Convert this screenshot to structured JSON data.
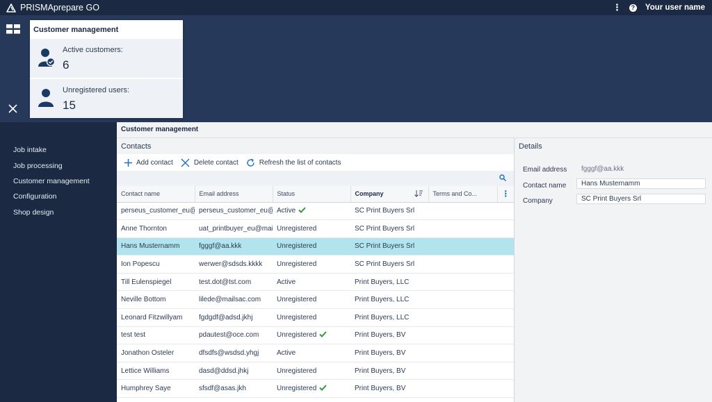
{
  "app": {
    "title": "PRISMAprepare GO",
    "user_name": "Your user name"
  },
  "nav": {
    "items": [
      {
        "label": "Job intake"
      },
      {
        "label": "Job processing"
      },
      {
        "label": "Customer management"
      },
      {
        "label": "Configuration"
      },
      {
        "label": "Shop design"
      }
    ]
  },
  "dashboard_card": {
    "title": "Customer management",
    "stats": [
      {
        "label": "Active customers:",
        "value": "6",
        "icon": "user-check-icon"
      },
      {
        "label": "Unregistered users:",
        "value": "15",
        "icon": "user-icon"
      }
    ]
  },
  "content": {
    "title": "Customer management",
    "contacts_title": "Contacts",
    "toolbar": {
      "add_label": "Add contact",
      "delete_label": "Delete contact",
      "refresh_label": "Refresh the list of contacts"
    },
    "columns": [
      "Contact name",
      "Email address",
      "Status",
      "Company",
      "Terms and Co..."
    ],
    "rows": [
      {
        "name": "perseus_customer_eu@n",
        "email": "perseus_customer_eu@n",
        "status": "Active",
        "check": true,
        "company": "SC Print Buyers Srl"
      },
      {
        "name": "Anne Thornton",
        "email": "uat_printbuyer_eu@mail",
        "status": "Unregistered",
        "check": false,
        "company": "SC Print Buyers Srl"
      },
      {
        "name": "Hans Musternamm",
        "email": "fgggf@aa.kkk",
        "status": "Unregistered",
        "check": false,
        "company": "SC Print Buyers Srl",
        "selected": true
      },
      {
        "name": "Ion Popescu",
        "email": "werwer@sdsds.kkkk",
        "status": "Unregistered",
        "check": false,
        "company": "SC Print Buyers Srl"
      },
      {
        "name": "Till Eulenspiegel",
        "email": "test.dot@tst.com",
        "status": "Active",
        "check": false,
        "company": "Print Buyers, LLC"
      },
      {
        "name": "Neville Bottom",
        "email": "lilede@mailsac.com",
        "status": "Unregistered",
        "check": false,
        "company": "Print Buyers, LLC"
      },
      {
        "name": "Leonard Fitzwillyam",
        "email": "fgdgdf@adsd.jkhj",
        "status": "Unregistered",
        "check": false,
        "company": "Print Buyers, LLC"
      },
      {
        "name": "test test",
        "email": "pdautest@oce.com",
        "status": "Unregistered",
        "check": true,
        "company": "Print Buyers, BV"
      },
      {
        "name": "Jonathon Osteler",
        "email": "dfsdfs@wsdsd.yhgj",
        "status": "Active",
        "check": false,
        "company": "Print Buyers, BV"
      },
      {
        "name": "Lettice Williams",
        "email": "dasd@ddsd.jhkj",
        "status": "Unregistered",
        "check": false,
        "company": "Print Buyers, BV"
      },
      {
        "name": "Humphrey Saye",
        "email": "sfsdf@asas.jkh",
        "status": "Unregistered",
        "check": true,
        "company": "Print Buyers, BV"
      }
    ]
  },
  "details": {
    "title": "Details",
    "email_label": "Email address",
    "email_value": "fgggf@aa.kkk",
    "name_label": "Contact name",
    "name_value": "Hans Musternamm",
    "company_label": "Company",
    "company_value": "SC Print Buyers Srl"
  },
  "colors": {
    "topbar": "#1b2a42",
    "header_band": "#26395a",
    "selected_row": "#b2e4ee",
    "accent": "#1f6fc6",
    "check": "#2e9b3c"
  }
}
